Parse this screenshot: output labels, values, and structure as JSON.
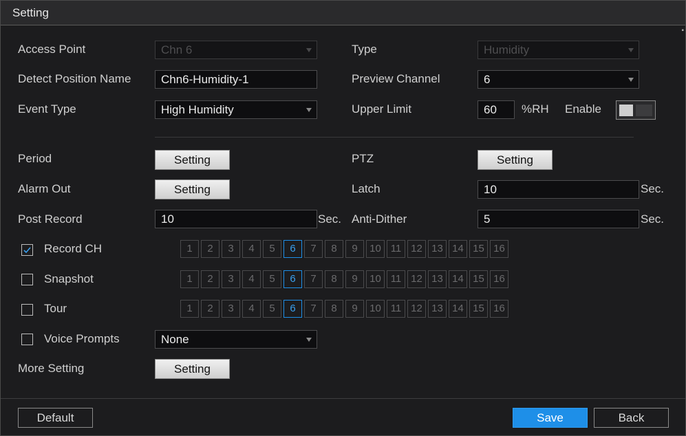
{
  "window": {
    "title": "Setting"
  },
  "form": {
    "access_point": {
      "label": "Access Point",
      "value": "Chn 6"
    },
    "type": {
      "label": "Type",
      "value": "Humidity"
    },
    "detect_position_name": {
      "label": "Detect Position Name",
      "value": "Chn6-Humidity-1"
    },
    "preview_channel": {
      "label": "Preview Channel",
      "value": "6"
    },
    "event_type": {
      "label": "Event Type",
      "value": "High Humidity"
    },
    "upper_limit": {
      "label": "Upper Limit",
      "value": "60",
      "unit": "%RH"
    },
    "enable": {
      "label": "Enable",
      "enabled": false
    },
    "period": {
      "label": "Period",
      "button": "Setting"
    },
    "ptz": {
      "label": "PTZ",
      "button": "Setting"
    },
    "alarm_out": {
      "label": "Alarm Out",
      "button": "Setting"
    },
    "latch": {
      "label": "Latch",
      "value": "10",
      "unit": "Sec."
    },
    "post_record": {
      "label": "Post Record",
      "value": "10",
      "unit": "Sec."
    },
    "anti_dither": {
      "label": "Anti-Dither",
      "value": "5",
      "unit": "Sec."
    },
    "record_ch": {
      "label": "Record CH",
      "checked": true
    },
    "snapshot": {
      "label": "Snapshot",
      "checked": false
    },
    "tour": {
      "label": "Tour",
      "checked": false
    },
    "voice_prompts": {
      "label": "Voice Prompts",
      "checked": false,
      "value": "None"
    },
    "more_setting": {
      "label": "More Setting",
      "button": "Setting"
    }
  },
  "channels": [
    "1",
    "2",
    "3",
    "4",
    "5",
    "6",
    "7",
    "8",
    "9",
    "10",
    "11",
    "12",
    "13",
    "14",
    "15",
    "16"
  ],
  "selected_channel": "6",
  "footer": {
    "default_label": "Default",
    "save_label": "Save",
    "back_label": "Back"
  },
  "colors": {
    "accent": "#1e8fe8",
    "background": "#1c1c1e"
  }
}
